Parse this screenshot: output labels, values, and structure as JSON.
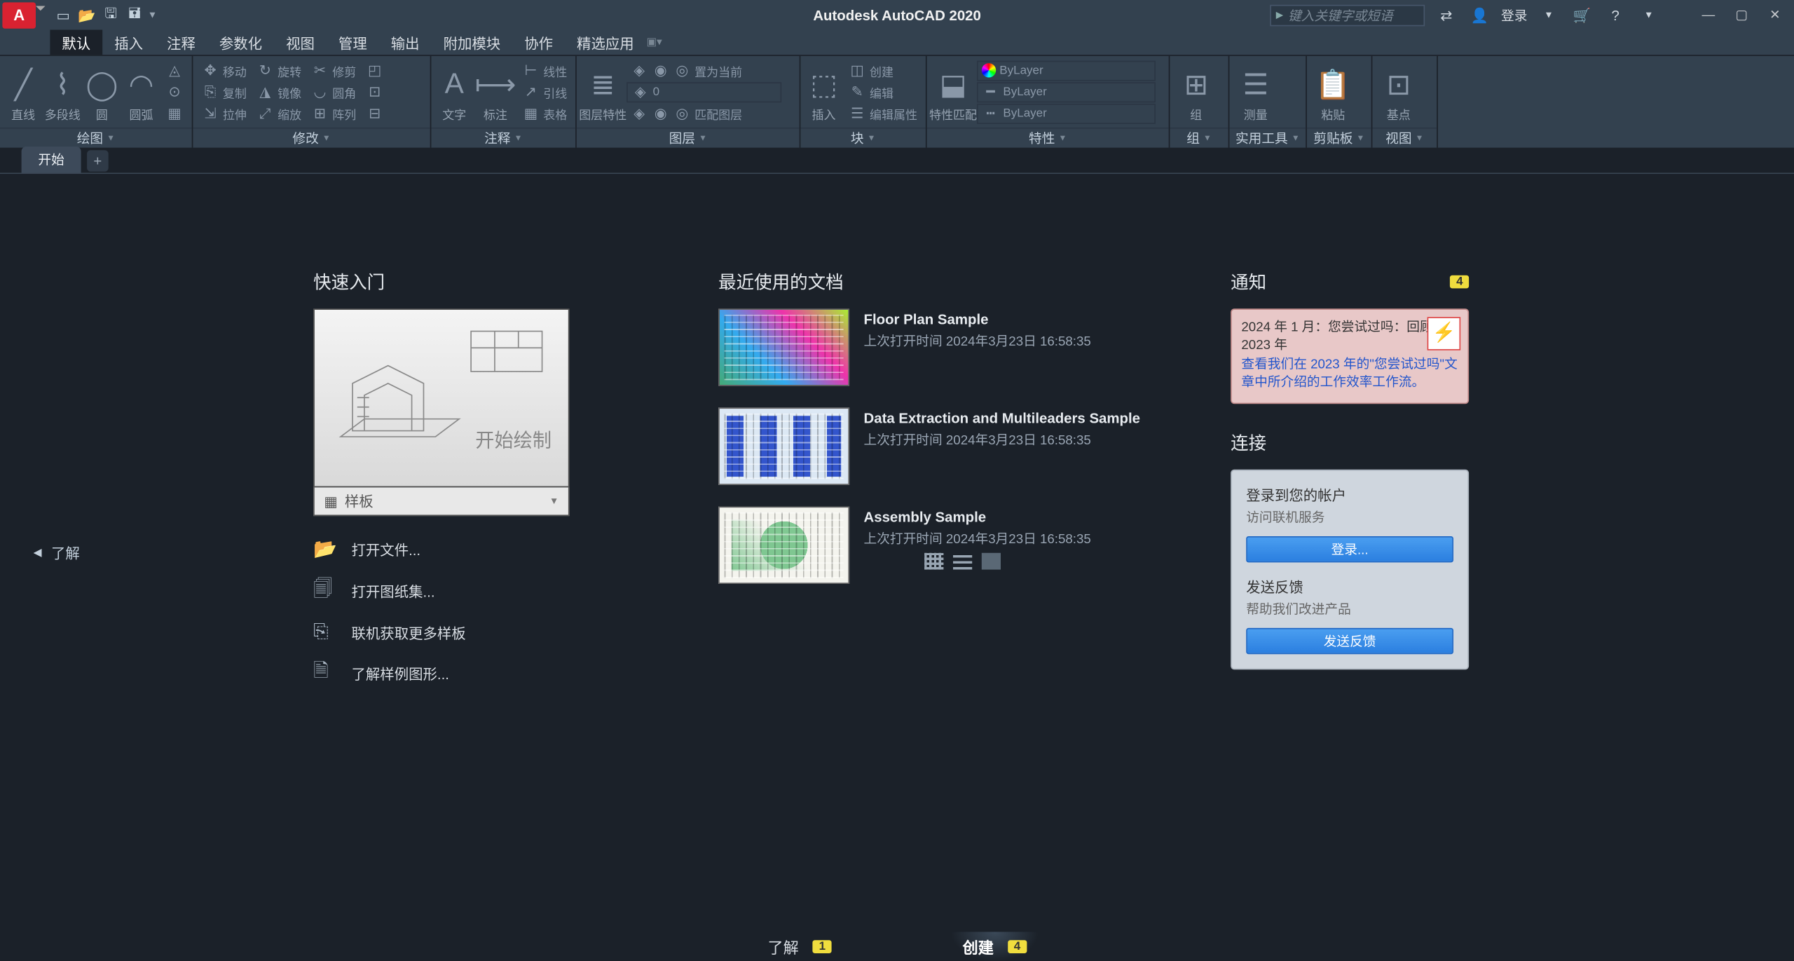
{
  "titlebar": {
    "app_letter": "A",
    "title": "Autodesk AutoCAD 2020",
    "search_placeholder": "键入关键字或短语",
    "signin": "登录"
  },
  "ribbon_tabs": [
    "默认",
    "插入",
    "注释",
    "参数化",
    "视图",
    "管理",
    "输出",
    "附加模块",
    "协作",
    "精选应用"
  ],
  "ribbon_tabs_active_index": 0,
  "panels": {
    "draw": {
      "title": "绘图",
      "items": [
        "直线",
        "多段线",
        "圆",
        "圆弧"
      ]
    },
    "modify": {
      "title": "修改",
      "rows": [
        [
          "移动",
          "旋转",
          "修剪"
        ],
        [
          "复制",
          "镜像",
          "圆角"
        ],
        [
          "拉伸",
          "缩放",
          "阵列"
        ]
      ]
    },
    "annotate": {
      "title": "注释",
      "items": [
        "文字",
        "标注",
        "表格"
      ],
      "rows": [
        [
          "线性"
        ],
        [
          "引线"
        ]
      ]
    },
    "layers": {
      "title": "图层",
      "items": [
        "图层特性"
      ],
      "rows": [
        [
          "…",
          "…",
          "置为当前"
        ],
        [
          "…",
          "…",
          "匹配图层"
        ]
      ]
    },
    "block": {
      "title": "块",
      "items": [
        "插入"
      ],
      "rows": [
        [
          "创建"
        ],
        [
          "编辑"
        ],
        [
          "编辑属性"
        ]
      ]
    },
    "properties": {
      "title": "特性",
      "items": [
        "特性匹配"
      ]
    },
    "group": {
      "title": "组",
      "items": [
        "组"
      ]
    },
    "utilities": {
      "title": "实用工具",
      "items": [
        "测量"
      ]
    },
    "clipboard": {
      "title": "剪贴板",
      "items": [
        "粘贴"
      ]
    },
    "view": {
      "title": "视图",
      "items": [
        "基点"
      ]
    }
  },
  "doc_tabs": {
    "start": "开始"
  },
  "left_nav": "了解",
  "start": {
    "quick_title": "快速入门",
    "big_card_text": "开始绘制",
    "template_label": "样板",
    "links": [
      "打开文件...",
      "打开图纸集...",
      "联机获取更多样板",
      "了解样例图形..."
    ],
    "recent_title": "最近使用的文档",
    "recent": [
      {
        "name": "Floor Plan Sample",
        "time": "上次打开时间 2024年3月23日 16:58:35"
      },
      {
        "name": "Data Extraction and Multileaders Sample",
        "time": "上次打开时间 2024年3月23日 16:58:35"
      },
      {
        "name": "Assembly Sample",
        "time": "上次打开时间 2024年3月23日 16:58:35"
      }
    ],
    "notif_title": "通知",
    "notif_badge": "4",
    "notif_text_1": "2024 年 1 月：您尝试过吗：回顾 2023 年",
    "notif_link": "查看我们在 2023 年的\"您尝试过吗\"文章中所介绍的工作效率工作流。",
    "connect_title": "连接",
    "connect": {
      "h1": "登录到您的帐户",
      "s1": "访问联机服务",
      "b1": "登录...",
      "h2": "发送反馈",
      "s2": "帮助我们改进产品",
      "b2": "发送反馈"
    }
  },
  "bottom_nav": {
    "learn": "了解",
    "learn_badge": "1",
    "create": "创建",
    "create_badge": "4"
  }
}
